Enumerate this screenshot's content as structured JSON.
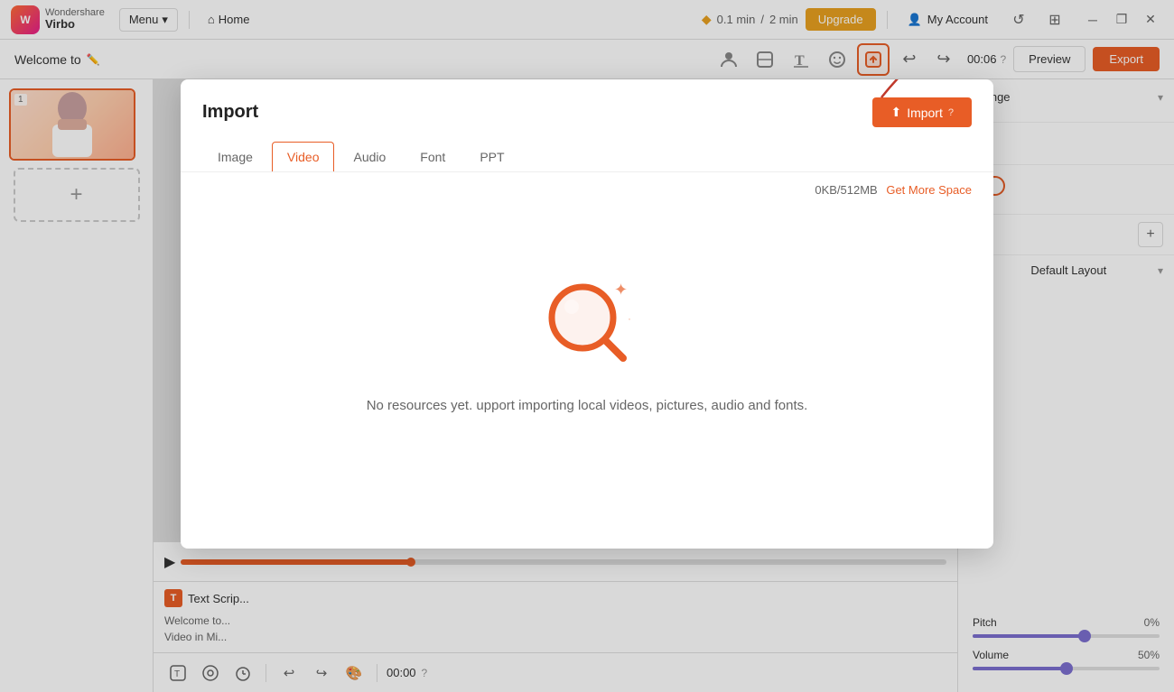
{
  "app": {
    "brand": "Wondershare",
    "product": "Virbo",
    "menu_label": "Menu",
    "home_label": "Home"
  },
  "topbar": {
    "time_used": "0.1 min",
    "time_total": "2 min",
    "time_separator": "/",
    "upgrade_label": "Upgrade",
    "account_label": "My Account"
  },
  "toolbar2": {
    "project_title": "Welcome to",
    "time_display": "00:06",
    "preview_label": "Preview",
    "export_label": "Export"
  },
  "tools": [
    {
      "name": "avatar-tool",
      "icon": "👤"
    },
    {
      "name": "sticker-tool",
      "icon": "✏️"
    },
    {
      "name": "text-tool",
      "icon": "T"
    },
    {
      "name": "emoji-tool",
      "icon": "🙂"
    },
    {
      "name": "upload-tool",
      "icon": "📤",
      "active": true
    }
  ],
  "slide": {
    "number": "1",
    "script_header": "Text Scrip...",
    "script_line1": "Welcome to...",
    "script_line2": "Video in Mi..."
  },
  "right_panel": {
    "change_label": "Change",
    "add_label": "+",
    "default_layout_label": "Default Layout"
  },
  "sliders": {
    "pitch_label": "Pitch",
    "pitch_value": "0%",
    "pitch_fill": 60,
    "volume_label": "Volume",
    "volume_value": "50%",
    "volume_fill": 50
  },
  "modal": {
    "title": "Import",
    "import_btn_label": "Import",
    "tabs": [
      {
        "id": "image",
        "label": "Image"
      },
      {
        "id": "video",
        "label": "Video",
        "active": true
      },
      {
        "id": "audio",
        "label": "Audio"
      },
      {
        "id": "font",
        "label": "Font"
      },
      {
        "id": "ppt",
        "label": "PPT"
      }
    ],
    "storage_used": "0KB/512MB",
    "get_more_label": "Get More Space",
    "empty_text": "No resources yet. upport importing local videos, pictures, audio and fonts."
  }
}
